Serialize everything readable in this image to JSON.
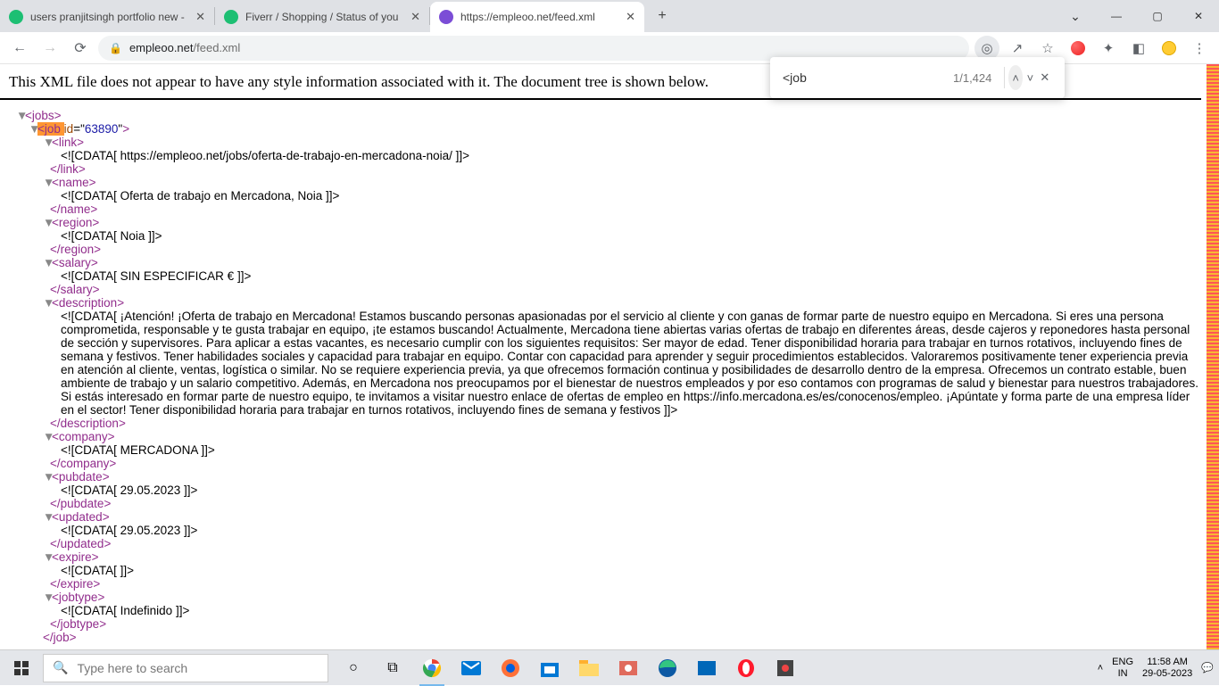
{
  "tabs": [
    {
      "title": "users pranjitsingh portfolio new -"
    },
    {
      "title": "Fiverr / Shopping / Status of you"
    },
    {
      "title": "https://empleoo.net/feed.xml"
    }
  ],
  "url": {
    "domain": "empleoo.net",
    "path": "/feed.xml"
  },
  "find": {
    "query": "<job",
    "count": "1/1,424"
  },
  "notice": "This XML file does not appear to have any style information associated with it. The document tree is shown below.",
  "xml": {
    "job_id": "63890",
    "link": "https://empleoo.net/jobs/oferta-de-trabajo-en-mercadona-noia/",
    "name": "Oferta de trabajo en Mercadona, Noia",
    "region": "Noia",
    "salary": "SIN ESPECIFICAR €",
    "description": "¡Atención! ¡Oferta de trabajo en Mercadona! Estamos buscando personas apasionadas por el servicio al cliente y con ganas de formar parte de nuestro equipo en Mercadona. Si eres una persona comprometida, responsable y te gusta trabajar en equipo, ¡te estamos buscando! Actualmente, Mercadona tiene abiertas varias ofertas de trabajo en diferentes áreas, desde cajeros y reponedores hasta personal de sección y supervisores. Para aplicar a estas vacantes, es necesario cumplir con los siguientes requisitos: Ser mayor de edad. Tener disponibilidad horaria para trabajar en turnos rotativos, incluyendo fines de semana y festivos. Tener habilidades sociales y capacidad para trabajar en equipo. Contar con capacidad para aprender y seguir procedimientos establecidos. Valoraremos positivamente tener experiencia previa en atención al cliente, ventas, logística o similar. No se requiere experiencia previa, ya que ofrecemos formación continua y posibilidades de desarrollo dentro de la empresa. Ofrecemos un contrato estable, buen ambiente de trabajo y un salario competitivo. Además, en Mercadona nos preocupamos por el bienestar de nuestros empleados y por eso contamos con programas de salud y bienestar para nuestros trabajadores. Si estás interesado en formar parte de nuestro equipo, te invitamos a visitar nuestro enlace de ofertas de empleo en https://info.mercadona.es/es/conocenos/empleo. ¡Apúntate y forma parte de una empresa líder en el sector! Tener disponibilidad horaria para trabajar en turnos rotativos, incluyendo fines de semana y festivos",
    "company": "MERCADONA",
    "pubdate": "29.05.2023",
    "updated": "29.05.2023",
    "expire": "",
    "jobtype": "Indefinido"
  },
  "taskbar": {
    "search_placeholder": "Type here to search"
  },
  "systray": {
    "lang1": "ENG",
    "lang2": "IN",
    "time": "11:58 AM",
    "date": "29-05-2023"
  }
}
